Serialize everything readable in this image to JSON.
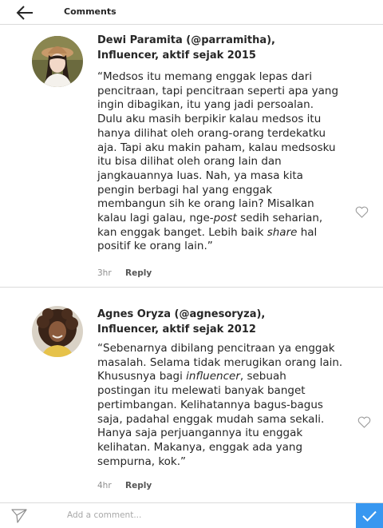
{
  "header": {
    "title": "Comments",
    "back_icon": "arrow-left-icon"
  },
  "comments": [
    {
      "author": [
        "Dewi Paramita (@parramitha),",
        "Influencer, aktif sejak 2015"
      ],
      "lines": [
        "“Medsos itu memang enggak lepas dari",
        "pencitraan, tapi pencitraan seperti apa yang",
        "ingin dibagikan, itu yang jadi persoalan.",
        "Dulu aku masih berpikir kalau medsos itu",
        "hanya dilihat oleh orang-orang terdekatku",
        "aja. Tapi aku makin paham, kalau medsosku",
        "itu bisa dilihat oleh orang lain dan",
        "jangkauannya luas. Nah, ya masa kita",
        "pengin berbagi hal yang enggak",
        "membangun sih ke orang lain? Misalkan",
        [
          "kalau lagi galau, nge-",
          "post",
          " sedih seharian,"
        ],
        [
          "kan enggak banget. Lebih baik ",
          "share",
          " hal"
        ],
        "positif ke orang lain.”"
      ],
      "time": "3hr",
      "reply_label": "Reply"
    },
    {
      "author": [
        "Agnes Oryza (@agnesoryza),",
        "Influencer, aktif sejak 2012"
      ],
      "lines": [
        "“Sebenarnya dibilang pencitraan ya enggak",
        "masalah. Selama tidak merugikan orang lain.",
        [
          "Khususnya bagi ",
          "influencer",
          ", sebuah"
        ],
        "postingan itu melewati banyak banget",
        "pertimbangan. Kelihatannya bagus-bagus",
        "saja, padahal enggak mudah sama sekali.",
        "Hanya saja perjuangannya itu enggak",
        "kelihatan. Makanya, enggak ada yang",
        "sempurna, kok.”"
      ],
      "time": "4hr",
      "reply_label": "Reply"
    }
  ],
  "footer": {
    "placeholder": "Add a comment...",
    "send_icon": "paper-plane-icon",
    "post_icon": "checkmark-icon",
    "accent": "#3897f0"
  }
}
